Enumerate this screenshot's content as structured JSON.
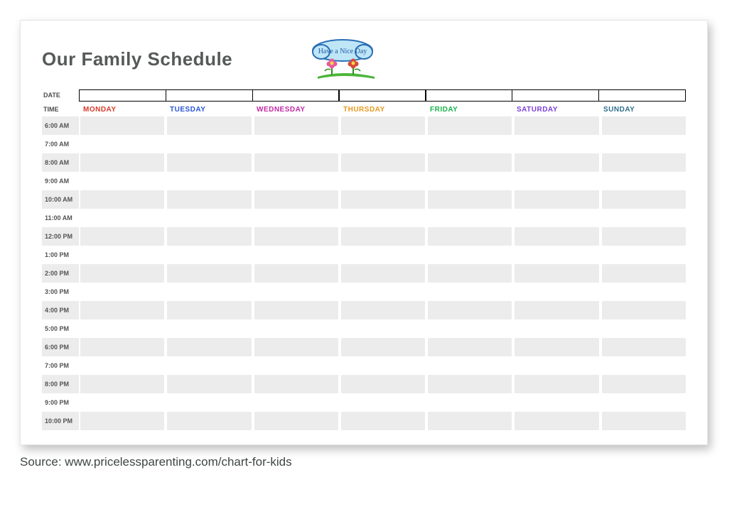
{
  "title": "Our Family Schedule",
  "clipart_caption": "Have a Nice Day",
  "labels": {
    "date": "DATE",
    "time": "TIME"
  },
  "days": [
    {
      "name": "MONDAY",
      "color": "#d63a2a"
    },
    {
      "name": "TUESDAY",
      "color": "#2a55d6"
    },
    {
      "name": "WEDNESDAY",
      "color": "#c02aa3"
    },
    {
      "name": "THURSDAY",
      "color": "#e89a1f"
    },
    {
      "name": "FRIDAY",
      "color": "#18b34a"
    },
    {
      "name": "SATURDAY",
      "color": "#7a3fd6"
    },
    {
      "name": "SUNDAY",
      "color": "#2e6e8c"
    }
  ],
  "times": [
    "6:00 AM",
    "7:00 AM",
    "8:00 AM",
    "9:00 AM",
    "10:00 AM",
    "11:00 AM",
    "12:00 PM",
    "1:00 PM",
    "2:00 PM",
    "3:00 PM",
    "4:00 PM",
    "5:00 PM",
    "6:00 PM",
    "7:00 PM",
    "8:00 PM",
    "9:00 PM",
    "10:00 PM"
  ],
  "source": "Source: www.pricelessparenting.com/chart-for-kids"
}
